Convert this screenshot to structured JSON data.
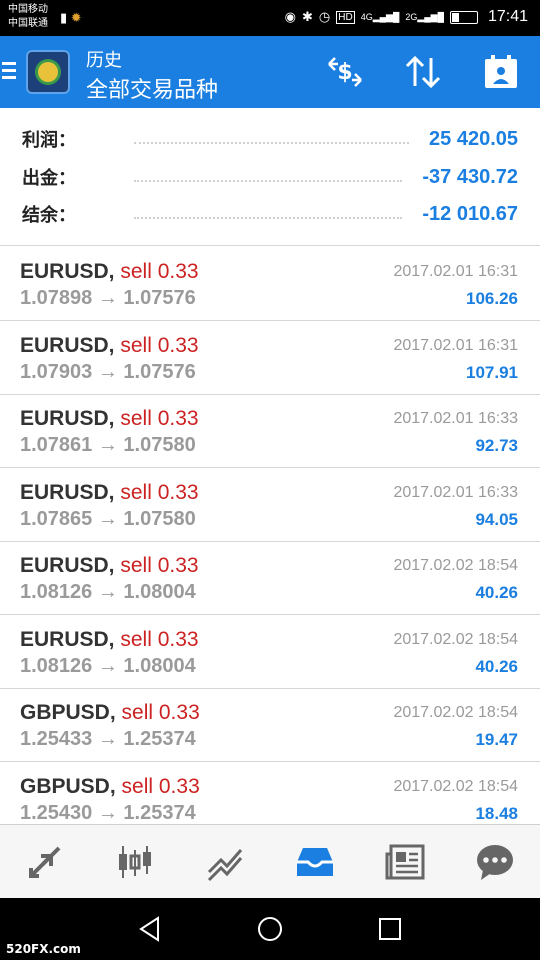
{
  "status_bar": {
    "carrier_line1": "中国移动",
    "carrier_line2": "中国联通",
    "network_1": "4G",
    "network_2": "2G",
    "time": "17:41",
    "icons": [
      "warning-icon",
      "sun-icon",
      "hotspot-icon",
      "bluetooth-icon",
      "alarm-icon",
      "hd-icon",
      "signal-icon",
      "battery-icon"
    ]
  },
  "header": {
    "title": "历史",
    "subtitle": "全部交易品种",
    "actions": [
      "deposit-withdraw-icon",
      "sort-icon",
      "calendar-icon"
    ],
    "accent_color": "#1a7fe0"
  },
  "summary": [
    {
      "label": "利润：",
      "value": "25 420.05"
    },
    {
      "label": "出金：",
      "value": "-37 430.72"
    },
    {
      "label": "结余：",
      "value": "-12 010.67"
    }
  ],
  "trades": [
    {
      "symbol": "EURUSD,",
      "side": "sell 0.33",
      "open": "1.07898",
      "arrow": "→",
      "close": "1.07576",
      "time": "2017.02.01 16:31",
      "profit": "106.26"
    },
    {
      "symbol": "EURUSD,",
      "side": "sell 0.33",
      "open": "1.07903",
      "arrow": "→",
      "close": "1.07576",
      "time": "2017.02.01 16:31",
      "profit": "107.91"
    },
    {
      "symbol": "EURUSD,",
      "side": "sell 0.33",
      "open": "1.07861",
      "arrow": "→",
      "close": "1.07580",
      "time": "2017.02.01 16:33",
      "profit": "92.73"
    },
    {
      "symbol": "EURUSD,",
      "side": "sell 0.33",
      "open": "1.07865",
      "arrow": "→",
      "close": "1.07580",
      "time": "2017.02.01 16:33",
      "profit": "94.05"
    },
    {
      "symbol": "EURUSD,",
      "side": "sell 0.33",
      "open": "1.08126",
      "arrow": "→",
      "close": "1.08004",
      "time": "2017.02.02 18:54",
      "profit": "40.26"
    },
    {
      "symbol": "EURUSD,",
      "side": "sell 0.33",
      "open": "1.08126",
      "arrow": "→",
      "close": "1.08004",
      "time": "2017.02.02 18:54",
      "profit": "40.26"
    },
    {
      "symbol": "GBPUSD,",
      "side": "sell 0.33",
      "open": "1.25433",
      "arrow": "→",
      "close": "1.25374",
      "time": "2017.02.02 18:54",
      "profit": "19.47"
    },
    {
      "symbol": "GBPUSD,",
      "side": "sell 0.33",
      "open": "1.25430",
      "arrow": "→",
      "close": "1.25374",
      "time": "2017.02.02 18:54",
      "profit": "18.48"
    }
  ],
  "tabs": [
    {
      "icon": "quotes-icon",
      "active": false
    },
    {
      "icon": "chart-icon",
      "active": false
    },
    {
      "icon": "trade-icon",
      "active": false
    },
    {
      "icon": "history-icon",
      "active": true
    },
    {
      "icon": "news-icon",
      "active": false
    },
    {
      "icon": "messages-icon",
      "active": false
    }
  ],
  "nav": [
    "back-icon",
    "home-icon",
    "recents-icon"
  ],
  "watermark": "520FX.com"
}
